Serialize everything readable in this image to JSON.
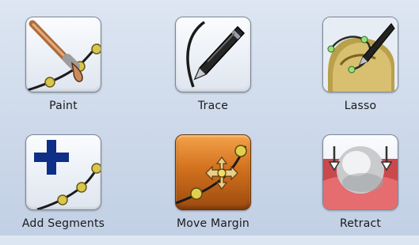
{
  "tools": [
    {
      "label": "Paint",
      "icon": "paint-brush-icon",
      "active": false
    },
    {
      "label": "Trace",
      "icon": "trace-pen-icon",
      "active": false
    },
    {
      "label": "Lasso",
      "icon": "lasso-icon",
      "active": false
    },
    {
      "label": "Add Segments",
      "icon": "add-segments-icon",
      "active": false
    },
    {
      "label": "Move Margin",
      "icon": "move-margin-icon",
      "active": true
    },
    {
      "label": "Retract",
      "icon": "retract-icon",
      "active": false
    }
  ],
  "colors": {
    "background": "#cdd9ea",
    "active_tile": "#d2711e",
    "point_gold": "#d6c24a",
    "plus_blue": "#0d2f86"
  }
}
